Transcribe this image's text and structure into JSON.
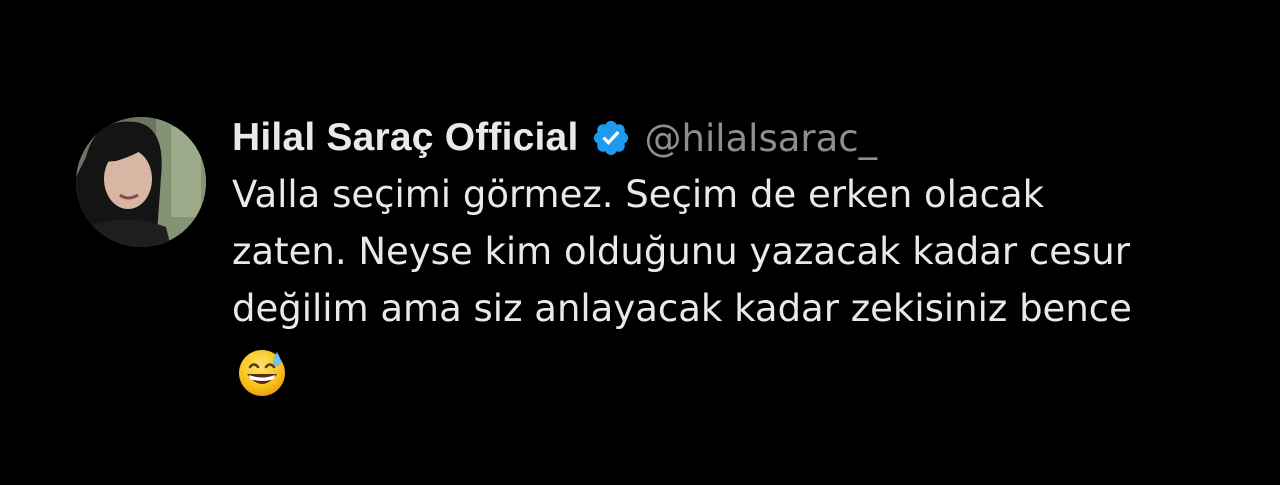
{
  "tweet": {
    "display_name": "Hilal Saraç Official",
    "handle": "@hilalsarac_",
    "verified_icon": "verified-badge-icon",
    "text_lines": [
      "Valla seçimi görmez. Seçim de erken olacak",
      "zaten. Neyse kim olduğunu yazacak kadar cesur",
      "değilim ama siz anlayacak kadar zekisiniz bence"
    ],
    "emoji": "grinning-face-with-sweat-emoji"
  },
  "colors": {
    "background": "#000000",
    "text_primary": "#e7e9ea",
    "text_secondary": "#8b8f93",
    "verified_blue": "#1d9bf0"
  }
}
